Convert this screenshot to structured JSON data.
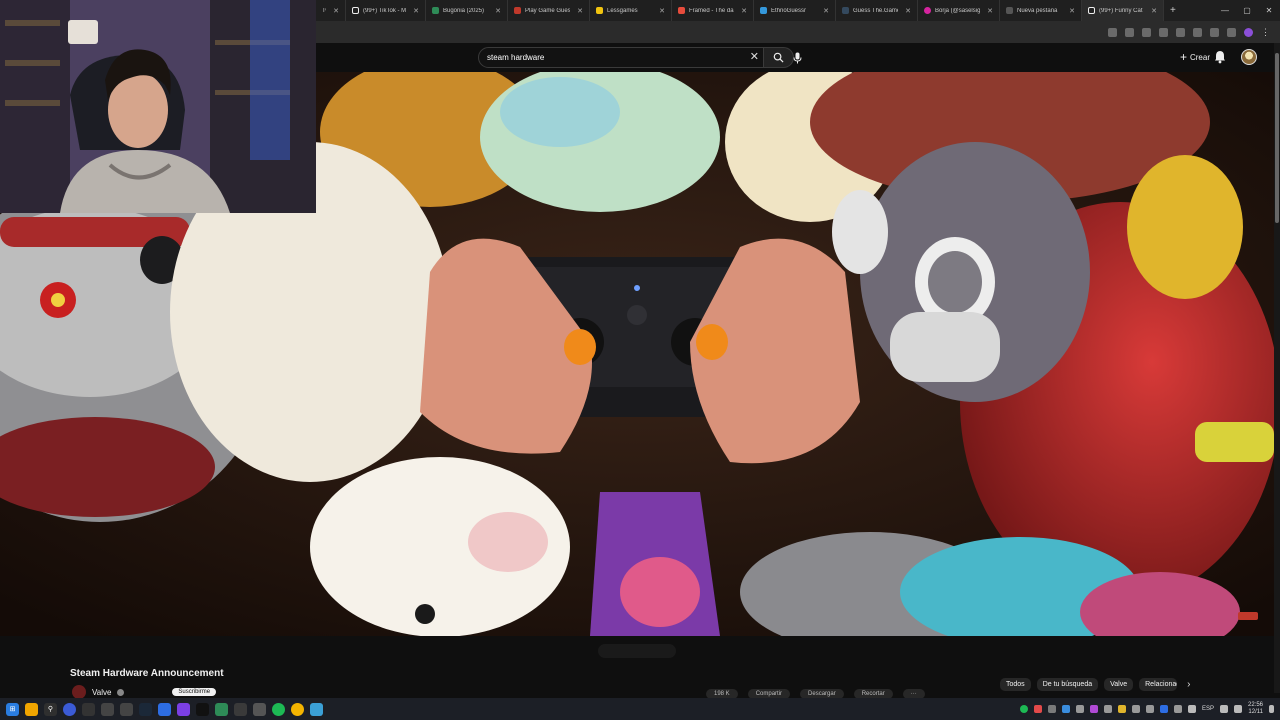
{
  "browser": {
    "tabs": [
      {
        "label": "Tw",
        "color": "#9146ff"
      },
      {
        "label": "(99+) TikTok - Ma",
        "color": "#111111"
      },
      {
        "label": "Bugonia (2025)",
        "color": "#2e8b57"
      },
      {
        "label": "Play Game Guess",
        "color": "#c0392b"
      },
      {
        "label": "Lessgames",
        "color": "#f1c40f"
      },
      {
        "label": "Framed - The dai",
        "color": "#e74c3c"
      },
      {
        "label": "EthnoGuessr",
        "color": "#3498db"
      },
      {
        "label": "Guess The.Game",
        "color": "#34495e"
      },
      {
        "label": "Borja (@saselsig",
        "color": "#d6249f"
      },
      {
        "label": "Nueva pestaña",
        "color": "#555555"
      },
      {
        "label": "(99+) Funny Cat",
        "color": "#111111"
      }
    ],
    "new_tab": "+",
    "window_controls": [
      "—",
      "▢",
      "✕"
    ]
  },
  "youtube": {
    "search": {
      "value": "steam hardware",
      "clear": "✕"
    },
    "create_label": "Crear",
    "create_plus": "+",
    "video": {
      "title": "Steam Hardware Announcement",
      "channel": "Valve",
      "subscribe_label": "Suscribirme",
      "actions": [
        "198 K",
        "Compartir",
        "Descargar",
        "Recortar",
        "···"
      ]
    },
    "chips": [
      "Todos",
      "De tu búsqueda",
      "Valve",
      "Relacionad"
    ],
    "chips_next": "›"
  },
  "taskbar": {
    "lang": "ESP",
    "time": "22:56",
    "date": "12/11"
  }
}
